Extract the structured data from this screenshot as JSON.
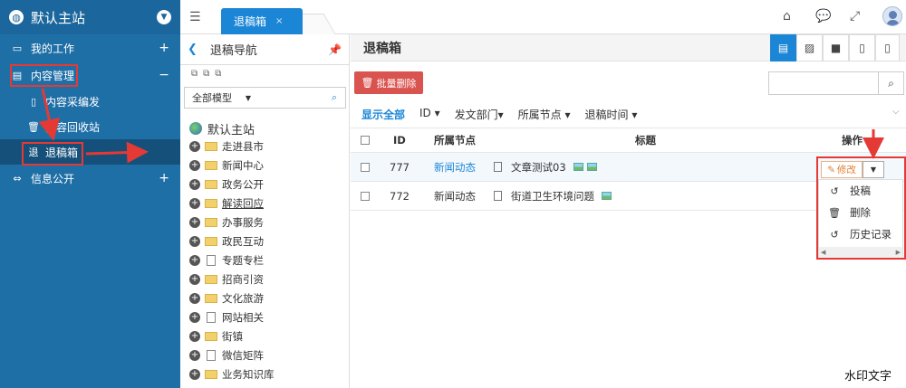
{
  "sidebar": {
    "brand": "默认主站",
    "menus": [
      {
        "label": "我的工作",
        "sign": "+"
      },
      {
        "label": "内容管理",
        "sign": "−"
      },
      {
        "label": "信息公开",
        "sign": "+"
      }
    ],
    "subitems": [
      {
        "label": "内容采编发",
        "icon": "doc-icon"
      },
      {
        "label": "内容回收站",
        "icon": "trash-icon"
      },
      {
        "label": "退稿箱",
        "icon": "退",
        "active": true
      }
    ]
  },
  "topbar": {
    "tab_label": "退稿箱",
    "tab_close": "×",
    "icons": [
      "home-icon",
      "chat-icon",
      "fullscreen-icon",
      "user-avatar"
    ]
  },
  "nav": {
    "title": "退稿导航",
    "filter_label": "全部模型",
    "tree_root": "默认主站",
    "tree_items": [
      {
        "label": "走进县市",
        "kind": "folder",
        "expand": true
      },
      {
        "label": "新闻中心",
        "kind": "folder",
        "expand": true
      },
      {
        "label": "政务公开",
        "kind": "folder",
        "expand": true
      },
      {
        "label": "解读回应",
        "kind": "folder",
        "expand": true,
        "underline": true
      },
      {
        "label": "办事服务",
        "kind": "folder",
        "expand": true
      },
      {
        "label": "政民互动",
        "kind": "folder",
        "expand": true
      },
      {
        "label": "专题专栏",
        "kind": "doc",
        "expand": true
      },
      {
        "label": "招商引资",
        "kind": "folder",
        "expand": true
      },
      {
        "label": "文化旅游",
        "kind": "folder",
        "expand": true
      },
      {
        "label": "网站相关",
        "kind": "doc",
        "expand": true
      },
      {
        "label": "街镇",
        "kind": "folder",
        "expand": true
      },
      {
        "label": "微信矩阵",
        "kind": "doc",
        "expand": true
      },
      {
        "label": "业务知识库",
        "kind": "folder",
        "expand": true
      }
    ]
  },
  "main": {
    "title": "退稿箱",
    "view_tabs": [
      "document-icon",
      "image-icon",
      "video-icon",
      "file-icon",
      "file2-icon"
    ],
    "batch_delete": "批量删除",
    "search_placeholder": "",
    "filters": [
      "显示全部",
      "ID ▾",
      "发文部门▾",
      "所属节点 ▾",
      "退稿时间 ▾"
    ],
    "columns": {
      "id": "ID",
      "node": "所属节点",
      "title": "标题",
      "ops": "操作"
    },
    "rows": [
      {
        "id": "777",
        "node": "新闻动态",
        "title": "文章测试03",
        "images": 2
      },
      {
        "id": "772",
        "node": "新闻动态",
        "title": "街道卫生环境问题",
        "images": 1
      }
    ],
    "edit_label": "修改",
    "dropdown": [
      {
        "label": "投稿",
        "icon": "undo-icon"
      },
      {
        "label": "删除",
        "icon": "trash-icon"
      },
      {
        "label": "历史记录",
        "icon": "history-icon"
      }
    ]
  },
  "watermark": "水印文字",
  "colors": {
    "sidebar": "#1f6fa7",
    "accent": "#1c86d6",
    "danger": "#d9534f",
    "annotation": "#e53935"
  }
}
